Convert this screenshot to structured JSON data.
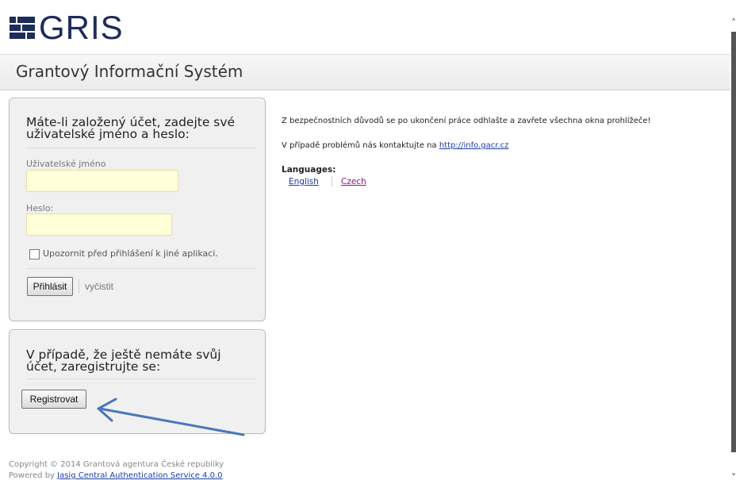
{
  "brand": {
    "logo_text": "GRIS"
  },
  "header": {
    "title": "Grantový Informační Systém"
  },
  "login": {
    "heading_line1": "Máte-li založený účet, zadejte své",
    "heading_line2": "uživatelské jméno a heslo:",
    "username_label": "Uživatelské jméno",
    "username_value": "",
    "password_label": "Heslo:",
    "password_value": "",
    "warn_checkbox_label": "Upozornit před přihlášení k jiné aplikaci.",
    "warn_checked": false,
    "submit_label": "Přihlásit",
    "clear_label": "vyčistit"
  },
  "register": {
    "heading_line1": "V případě, že ještě nemáte svůj",
    "heading_line2": "účet, zaregistrujte se:",
    "button_label": "Registrovat"
  },
  "info": {
    "security_notice": "Z bezpečnostních důvodů se po ukončení práce odhlašte a zavřete všechna okna prohlížeče!",
    "contact_prefix": "V případě problémů nás kontaktujte na ",
    "contact_link": "http://info.gacr.cz",
    "languages_heading": "Languages:",
    "languages": [
      "English",
      "Czech"
    ]
  },
  "footer": {
    "copyright": "Copyright © 2014 Grantová agentura České republiky",
    "powered_prefix": "Powered by ",
    "powered_link": "Jasig Central Authentication Service 4.0.0"
  },
  "colors": {
    "brand": "#1d2c5a",
    "link": "#1a3caa",
    "visited_link": "#8a1a8a",
    "input_bg": "#ffffd8",
    "panel_bg": "#f0f0f0",
    "annotation_arrow": "#4a78b8"
  },
  "icons": {
    "scroll_up": "chevron-up-icon",
    "scroll_down": "chevron-down-icon"
  }
}
